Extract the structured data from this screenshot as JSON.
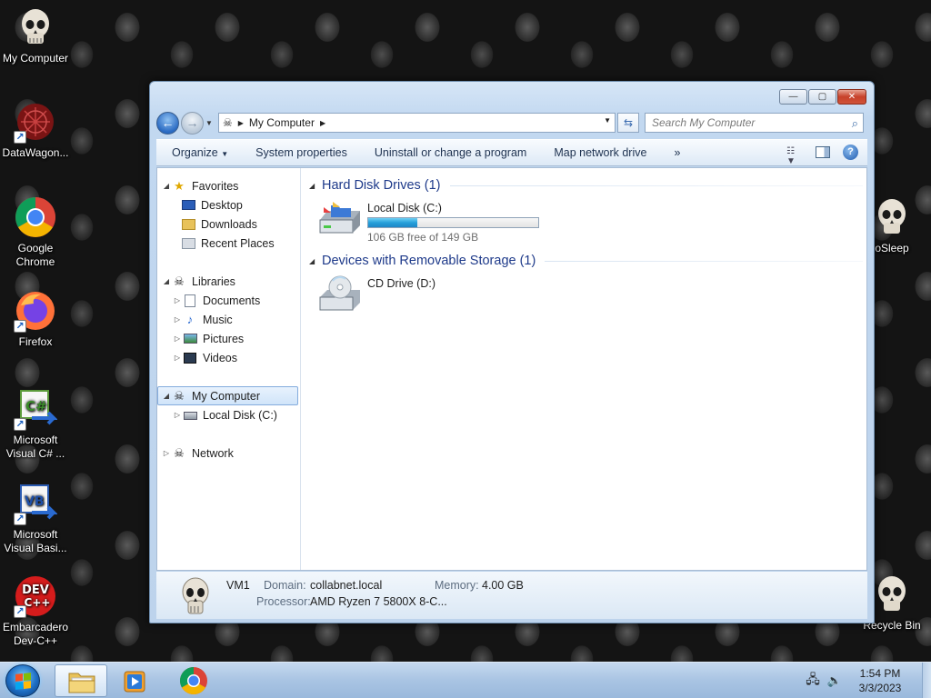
{
  "desktop": {
    "icons": [
      {
        "label": "My Computer",
        "icon": "skull-icon"
      },
      {
        "label": "DataWagon...",
        "icon": "datawagon-icon"
      },
      {
        "label": "Google Chrome",
        "icon": "chrome-icon"
      },
      {
        "label": "Firefox",
        "icon": "firefox-icon"
      },
      {
        "label": "Microsoft Visual C# ...",
        "icon": "visual-csharp-icon"
      },
      {
        "label": "Microsoft Visual Basi...",
        "icon": "visual-basic-icon"
      },
      {
        "label": "Embarcadero Dev-C++",
        "icon": "devcpp-icon"
      },
      {
        "label": "oSleep",
        "icon": "skull-icon"
      },
      {
        "label": "Recycle Bin",
        "icon": "skull-icon"
      }
    ],
    "devcpp_badge": "DEV\nC++",
    "csharp_badge": "C#",
    "vb_badge": "VB"
  },
  "window": {
    "controls": {
      "minimize": "—",
      "maximize": "▢",
      "close": "✕"
    },
    "address": {
      "crumb": "My Computer"
    },
    "search": {
      "placeholder": "Search My Computer"
    },
    "toolbar": {
      "organize": "Organize",
      "system_properties": "System properties",
      "uninstall": "Uninstall or change a program",
      "map_drive": "Map network drive",
      "more": "»"
    },
    "navpane": {
      "favorites": "Favorites",
      "desktop": "Desktop",
      "downloads": "Downloads",
      "recent_places": "Recent Places",
      "libraries": "Libraries",
      "documents": "Documents",
      "music": "Music",
      "pictures": "Pictures",
      "videos": "Videos",
      "my_computer": "My Computer",
      "local_disk": "Local Disk (C:)",
      "network": "Network"
    },
    "groups": {
      "hdd": "Hard Disk Drives (1)",
      "removable": "Devices with Removable Storage (1)"
    },
    "drives": {
      "c_name": "Local Disk (C:)",
      "c_free": "106 GB free of 149 GB",
      "c_used_fraction": 0.289,
      "d_name": "CD Drive (D:)"
    },
    "details": {
      "name": "VM1",
      "domain_label": "Domain:",
      "domain_value": "collabnet.local",
      "memory_label": "Memory:",
      "memory_value": "4.00 GB",
      "processor_label": "Processor:",
      "processor_value": "AMD Ryzen 7 5800X 8-C..."
    }
  },
  "taskbar": {
    "time": "1:54 PM",
    "date": "3/3/2023"
  },
  "colors": {
    "accent": "#1e3a8a",
    "bar_fill": "#26a0da",
    "taskbar": "#a9c4e3"
  }
}
